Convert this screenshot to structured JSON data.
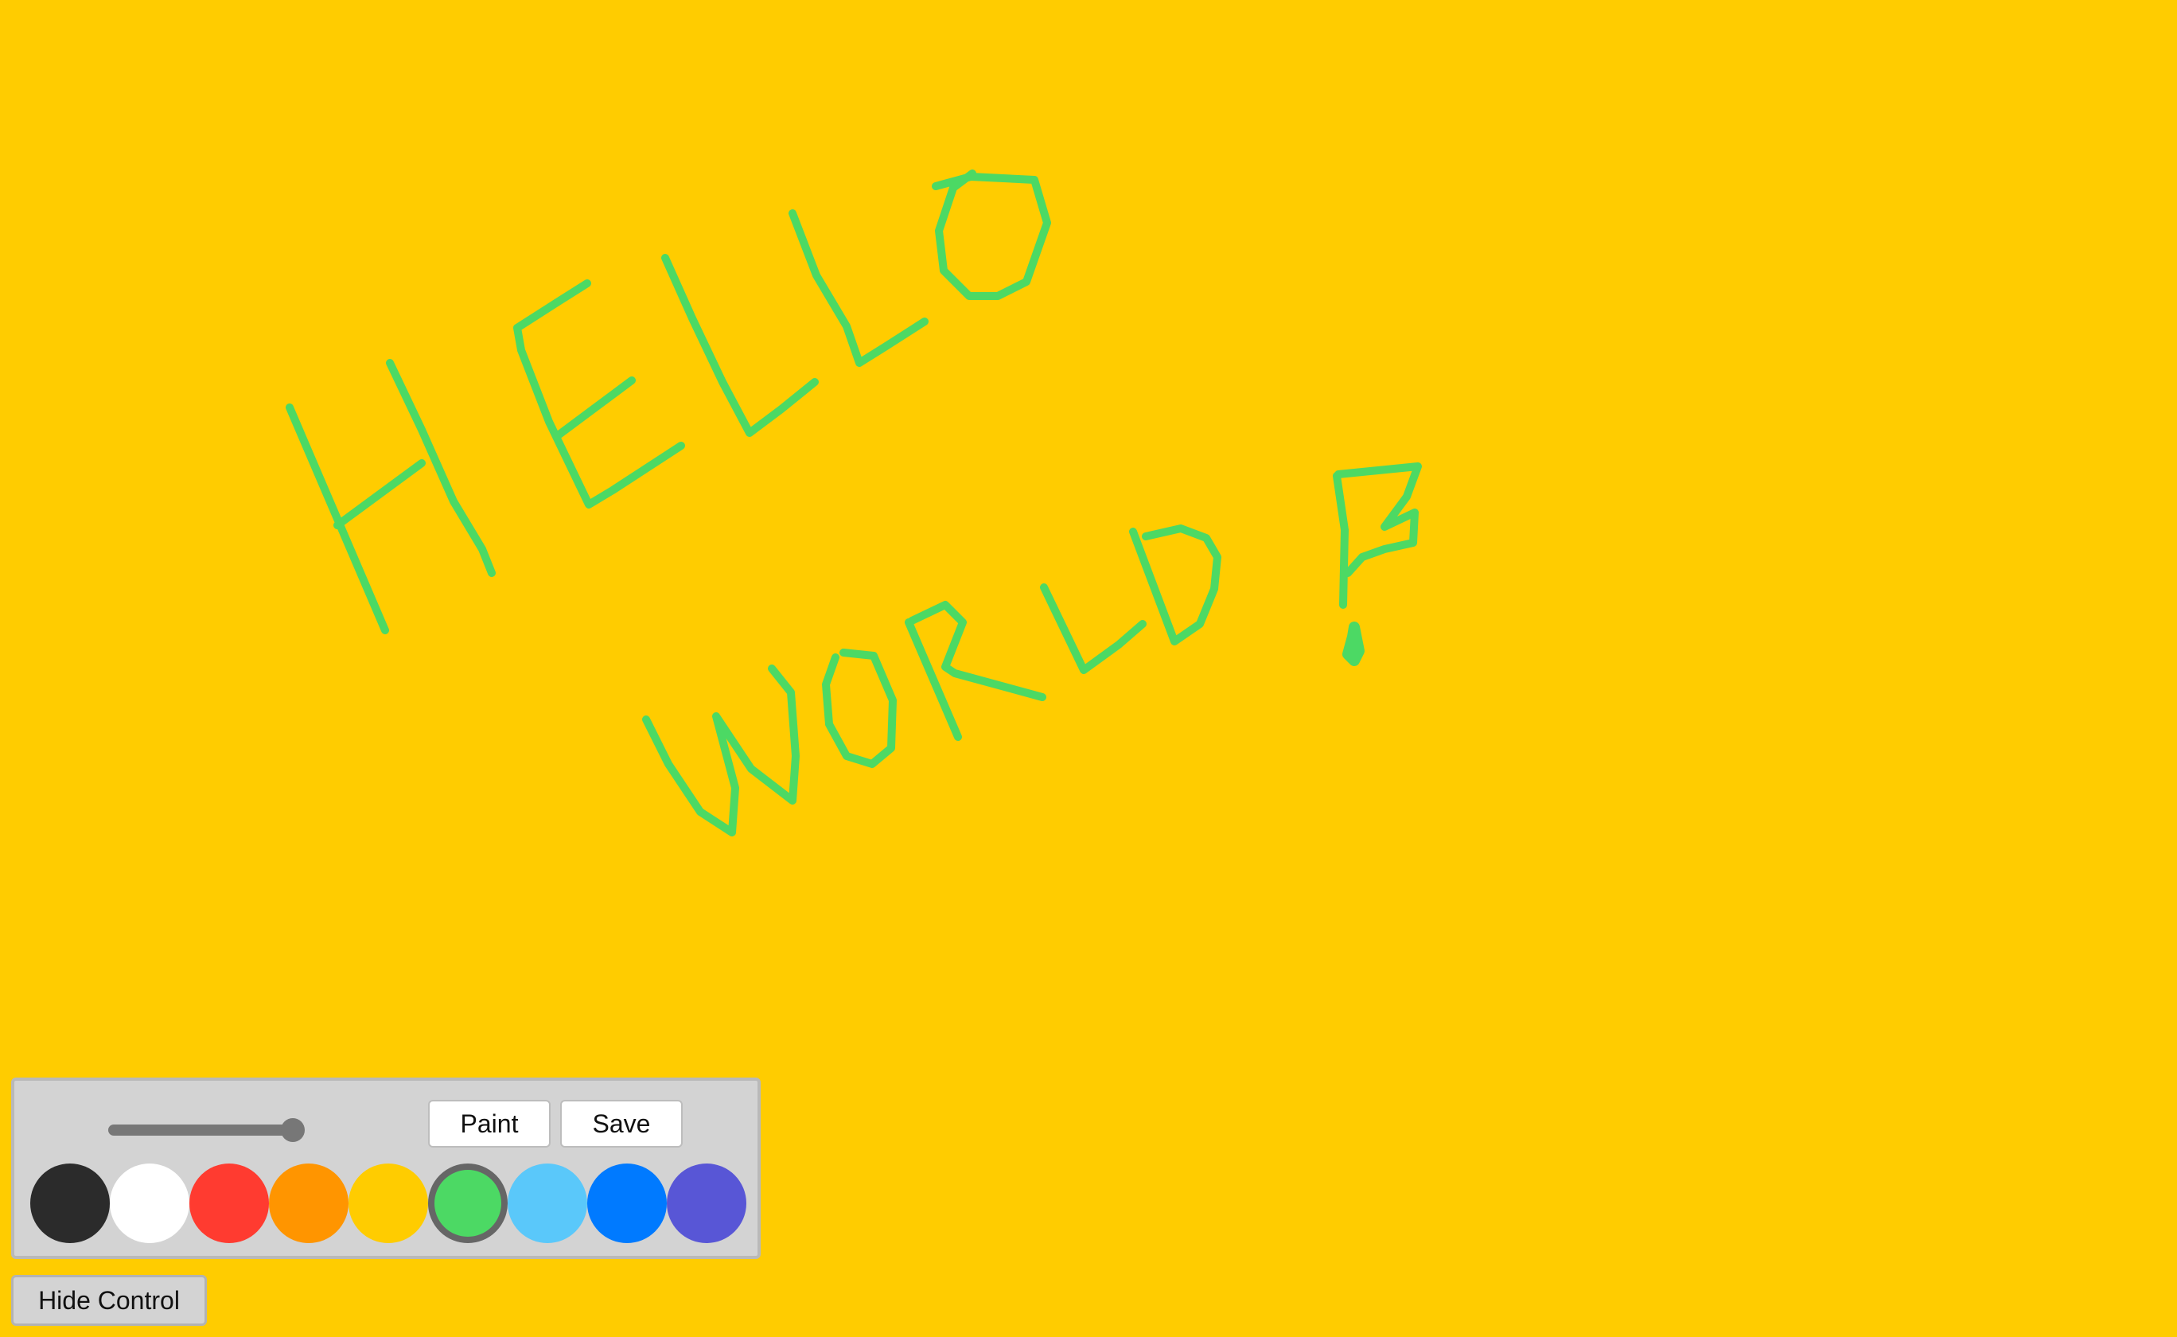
{
  "canvas": {
    "background": "#FFCC00",
    "stroke_color": "#4CD964",
    "drawing_text": "HELLO WORLD !"
  },
  "controls": {
    "brush_size_slider": {
      "value": 1.0,
      "min": 0,
      "max": 1
    },
    "paint_label": "Paint",
    "save_label": "Save",
    "palette": {
      "selected_index": 5,
      "colors": [
        "#2B2B2B",
        "#FFFFFF",
        "#FF3B30",
        "#FF9500",
        "#FFCC00",
        "#4CD964",
        "#5AC8FA",
        "#007AFF",
        "#5856D6"
      ]
    }
  },
  "hide_control_label": "Hide Control"
}
